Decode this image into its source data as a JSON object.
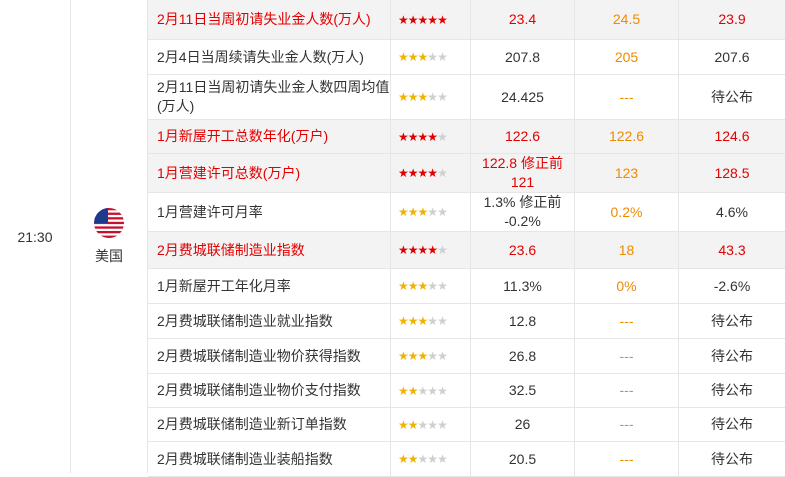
{
  "time": "21:30",
  "country": "美国",
  "rows": [
    {
      "name": "2月11日当周初请失业金人数(万人)",
      "stars": 5,
      "important": true,
      "prev": "23.4",
      "forecast": "24.5",
      "actual": "23.9",
      "prevColor": "red",
      "foreColor": "orange",
      "actColor": "red"
    },
    {
      "name": "2月4日当周续请失业金人数(万人)",
      "stars": 3,
      "important": false,
      "prev": "207.8",
      "forecast": "205",
      "actual": "207.6",
      "prevColor": "",
      "foreColor": "orange",
      "actColor": ""
    },
    {
      "name": "2月11日当周初请失业金人数四周均值(万人)",
      "stars": 3,
      "important": false,
      "prev": "24.425",
      "forecast": "---",
      "actual": "待公布",
      "prevColor": "",
      "foreColor": "orange",
      "actColor": ""
    },
    {
      "name": "1月新屋开工总数年化(万户)",
      "stars": 4,
      "important": true,
      "prev": "122.6",
      "forecast": "122.6",
      "actual": "124.6",
      "prevColor": "red",
      "foreColor": "orange",
      "actColor": "red"
    },
    {
      "name": "1月营建许可总数(万户)",
      "stars": 4,
      "important": true,
      "prev": "122.8 修正前 121",
      "forecast": "123",
      "actual": "128.5",
      "prevColor": "red",
      "foreColor": "orange",
      "actColor": "red"
    },
    {
      "name": "1月营建许可月率",
      "stars": 3,
      "important": false,
      "prev": "1.3% 修正前 -0.2%",
      "forecast": "0.2%",
      "actual": "4.6%",
      "prevColor": "",
      "foreColor": "orange",
      "actColor": ""
    },
    {
      "name": "2月费城联储制造业指数",
      "stars": 4,
      "important": true,
      "prev": "23.6",
      "forecast": "18",
      "actual": "43.3",
      "prevColor": "red",
      "foreColor": "orange",
      "actColor": "red"
    },
    {
      "name": "1月新屋开工年化月率",
      "stars": 3,
      "important": false,
      "prev": "11.3%",
      "forecast": "0%",
      "actual": "-2.6%",
      "prevColor": "",
      "foreColor": "orange",
      "actColor": ""
    },
    {
      "name": "2月费城联储制造业就业指数",
      "stars": 3,
      "important": false,
      "prev": "12.8",
      "forecast": "---",
      "actual": "待公布",
      "prevColor": "",
      "foreColor": "orange",
      "actColor": ""
    },
    {
      "name": "2月费城联储制造业物价获得指数",
      "stars": 3,
      "important": false,
      "prev": "26.8",
      "forecast": "---",
      "actual": "待公布",
      "prevColor": "",
      "foreColor": "orange",
      "actColor": ""
    },
    {
      "name": "2月费城联储制造业物价支付指数",
      "stars": 2,
      "important": false,
      "prev": "32.5",
      "forecast": "---",
      "actual": "待公布",
      "prevColor": "",
      "foreColor": "orange",
      "actColor": ""
    },
    {
      "name": "2月费城联储制造业新订单指数",
      "stars": 2,
      "important": false,
      "prev": "26",
      "forecast": "---",
      "actual": "待公布",
      "prevColor": "",
      "foreColor": "orange",
      "actColor": ""
    },
    {
      "name": "2月费城联储制造业装船指数",
      "stars": 2,
      "important": false,
      "prev": "20.5",
      "forecast": "---",
      "actual": "待公布",
      "prevColor": "",
      "foreColor": "orange",
      "actColor": ""
    }
  ]
}
